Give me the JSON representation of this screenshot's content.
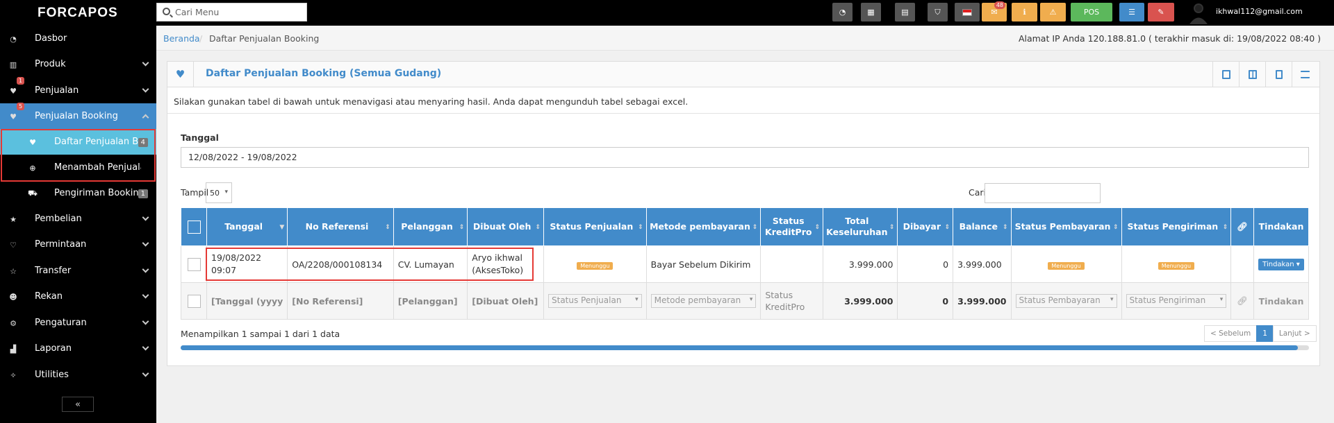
{
  "app": {
    "logo": "FORCAPOS",
    "search_placeholder": "Cari Menu"
  },
  "topbar": {
    "buttons": [
      {
        "icon": "dashboard-icon"
      },
      {
        "icon": "calculator-icon"
      },
      {
        "icon": "calendar-icon"
      },
      {
        "icon": "html5-icon"
      },
      {
        "icon": "flag-indonesia-icon"
      },
      {
        "icon": "mail-icon",
        "badge": "48"
      },
      {
        "icon": "info-icon"
      },
      {
        "icon": "warning-icon"
      },
      {
        "icon": "pos-icon",
        "label": "POS"
      },
      {
        "icon": "list-icon"
      },
      {
        "icon": "eraser-icon"
      }
    ],
    "user_email": "ikhwal112@gmail.com"
  },
  "sidebar": {
    "items": [
      {
        "label": "Dasbor",
        "icon": "dashboard-icon"
      },
      {
        "label": "Produk",
        "icon": "barcode-icon"
      },
      {
        "label": "Penjualan",
        "icon": "heart-icon",
        "badge": "1"
      },
      {
        "label": "Penjualan Booking",
        "icon": "heart-icon",
        "badge": "5"
      },
      {
        "label": "Pembelian",
        "icon": "star-icon"
      },
      {
        "label": "Permintaan",
        "icon": "heart-outline-icon"
      },
      {
        "label": "Transfer",
        "icon": "star-outline-icon"
      },
      {
        "label": "Rekan",
        "icon": "users-icon"
      },
      {
        "label": "Pengaturan",
        "icon": "cog-icon"
      },
      {
        "label": "Laporan",
        "icon": "bar-chart-icon"
      },
      {
        "label": "Utilities",
        "icon": "wrench-icon"
      }
    ],
    "subitems": [
      {
        "label": "Daftar Penjualan Booking",
        "count": "4"
      },
      {
        "label": "Menambah Penjualan Booking"
      },
      {
        "label": "Pengiriman Booking",
        "count": "1"
      }
    ],
    "collapse_label": "«"
  },
  "breadcrumb": {
    "home": "Beranda",
    "sep": "/",
    "current": "Daftar Penjualan Booking"
  },
  "ip_info": "Alamat IP Anda 120.188.81.0 ( terakhir masuk di: 19/08/2022 08:40 )",
  "page": {
    "title": "Daftar Penjualan Booking (Semua Gudang)",
    "intro": "Silakan gunakan tabel di bawah untuk menavigasi atau menyaring hasil. Anda dapat mengunduh tabel sebagai excel.",
    "date_label": "Tanggal",
    "date_range": "12/08/2022 - 19/08/2022",
    "show_label": "Tampil",
    "per_page": "50",
    "search_label": "Cari"
  },
  "table": {
    "headers": [
      "Tanggal",
      "No Referensi",
      "Pelanggan",
      "Dibuat Oleh",
      "Status Penjualan",
      "Metode pembayaran",
      "Status KreditPro",
      "Total Keseluruhan",
      "Dibayar",
      "Balance",
      "Status Pembayaran",
      "Status Pengiriman",
      "Tindakan"
    ],
    "row": {
      "tanggal": "19/08/2022 09:07",
      "ref": "OA/2208/000108134",
      "pelanggan": "CV. Lumayan",
      "dibuat": "Aryo ikhwal (AksesToko)",
      "status_penjualan": "Menunggu",
      "metode": "Bayar Sebelum Dikirim",
      "kreditpro": "",
      "total": "3.999.000",
      "dibayar": "0",
      "balance": "3.999.000",
      "status_pembayaran": "Menunggu",
      "status_pengiriman": "Menunggu",
      "tindakan": "Tindakan ▾"
    },
    "filter": {
      "tanggal": "[Tanggal (yyyy",
      "ref": "[No Referensi]",
      "pelanggan": "[Pelanggan]",
      "dibuat": "[Dibuat Oleh]",
      "status_penjualan": "Status Penjualan",
      "metode": "Metode pembayaran",
      "kreditpro": "Status KreditPro",
      "total": "3.999.000",
      "dibayar": "0",
      "balance": "3.999.000",
      "status_pembayaran": "Status Pembayaran",
      "status_pengiriman": "Status Pengiriman",
      "tindakan": "Tindakan"
    }
  },
  "footer": {
    "info": "Menampilkan 1 sampai 1 dari 1 data",
    "prev": "< Sebelum",
    "page": "1",
    "next": "Lanjut >",
    "scroll_fraction": 0.99
  },
  "colors": {
    "primary": "#428bca",
    "warning": "#f0ad4e",
    "danger": "#d9534f",
    "success": "#5cb85c",
    "info": "#5bc0de"
  }
}
